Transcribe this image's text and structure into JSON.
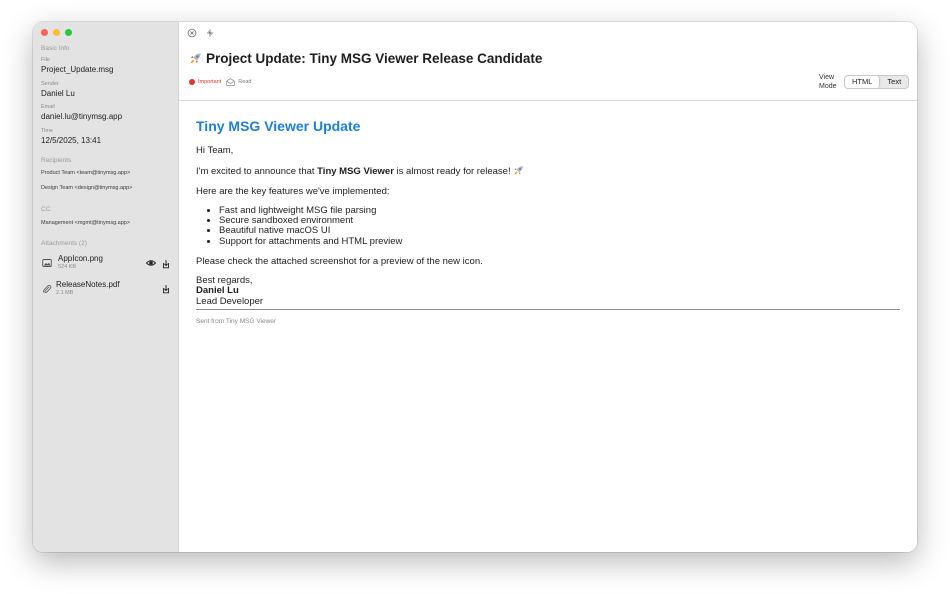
{
  "colors": {
    "close": "#ff5f57",
    "minimize": "#febc2e",
    "zoom": "#28c840",
    "accent_heading": "#1e7ed6",
    "important": "#e0352b"
  },
  "sidebar": {
    "basic_info_label": "Basic Info",
    "file_label": "File",
    "file_value": "Project_Update.msg",
    "sender_label": "Sender",
    "sender_value": "Daniel Lu",
    "email_label": "Email",
    "email_value": "daniel.lu@tinymsg.app",
    "time_label": "Time",
    "time_value": "12/5/2025, 13:41",
    "recipients_label": "Recipients",
    "recipients": [
      "Product Team <team@tinymsg.app>",
      "Design Team <design@tinymsg.app>"
    ],
    "cc_label": "CC",
    "cc": [
      "Management <mgmt@tinymsg.app>"
    ],
    "attachments_label": "Attachments (2)",
    "attachments": [
      {
        "name": "AppIcon.png",
        "size": "524 KB",
        "icon": "image-icon"
      },
      {
        "name": "ReleaseNotes.pdf",
        "size": "2.1 MB",
        "icon": "paperclip-icon"
      }
    ]
  },
  "toolbar": {
    "close_icon": "circle-x-icon",
    "new_icon": "sparkle-icon"
  },
  "header": {
    "subject": "Project Update: Tiny MSG Viewer Release Candidate",
    "important_label": "Important",
    "read_label": "Read",
    "view_mode_label": "View Mode",
    "html_label": "HTML",
    "text_label": "Text",
    "selected_mode": "HTML"
  },
  "email": {
    "heading": "Tiny MSG Viewer Update",
    "greeting": "Hi Team,",
    "announce_prefix": "I'm excited to announce that ",
    "announce_bold": "Tiny MSG Viewer",
    "announce_suffix": " is almost ready for release! ",
    "features_intro": "Here are the key features we've implemented:",
    "features": [
      "Fast and lightweight MSG file parsing",
      "Secure sandboxed environment",
      "Beautiful native macOS UI",
      "Support for attachments and HTML preview"
    ],
    "check_line": "Please check the attached screenshot for a preview of the new icon.",
    "regards": "Best regards,",
    "signature_name": "Daniel Lu",
    "signature_title": "Lead Developer",
    "footer": "Sent from Tiny MSG Viewer"
  }
}
